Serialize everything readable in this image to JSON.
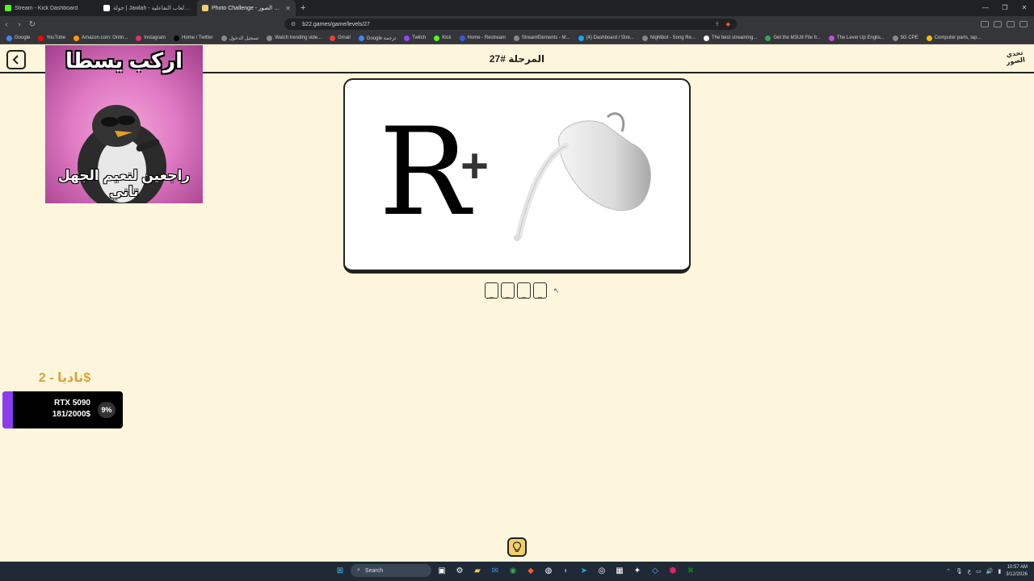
{
  "browser": {
    "tabs": [
      {
        "title": "Stream - Kick Dashboard",
        "active": false,
        "color": "#53fc18"
      },
      {
        "title": "جولة | Jawlah - منصة الألعاب التفاعلية",
        "active": false,
        "color": "#ffffff"
      },
      {
        "title": "Photo Challenge - تحدي الصور",
        "active": true,
        "color": "#f3cf6a"
      }
    ],
    "url": "b22.games/game/levels/27",
    "bookmarks": [
      "Google",
      "YouTube",
      "Amazon.com: Onlin...",
      "Instagram",
      "Home / Twitter",
      "تسجيل الدخول",
      "Watch trending vide...",
      "Gmail",
      "Google ترجمة",
      "Twitch",
      "Kick",
      "Home - Restream",
      "StreamElements - M...",
      "(4) Dashboard / Stre...",
      "Nightbot - Song Re...",
      "The best streaming...",
      "Get the M3U8 File fr...",
      "The Level Up Englis...",
      "5G CPE",
      "Computer parts, lap..."
    ]
  },
  "header": {
    "level_title": "المرحلة #27",
    "logo_text": "تحدي الصور"
  },
  "webcam": {
    "caption_top": "اركب يسطا",
    "caption_bottom": "راجعين لنعيم الجهل تاني"
  },
  "puzzle": {
    "letter": "R",
    "operator": "+",
    "image": "milk-jug-pouring",
    "answer_slots": [
      "_",
      "_",
      "_",
      "_"
    ]
  },
  "donation": {
    "donor": "ناديا - 2$",
    "goal_name": "RTX 5090",
    "goal_progress": "181/2000$",
    "percent": "9%",
    "percent_value": 9,
    "bar_color": "#8b3cf0"
  },
  "hint_button": "lightbulb-icon",
  "taskbar": {
    "search_label": "Search",
    "time": "10:57 AM",
    "date": "3/12/2026"
  }
}
